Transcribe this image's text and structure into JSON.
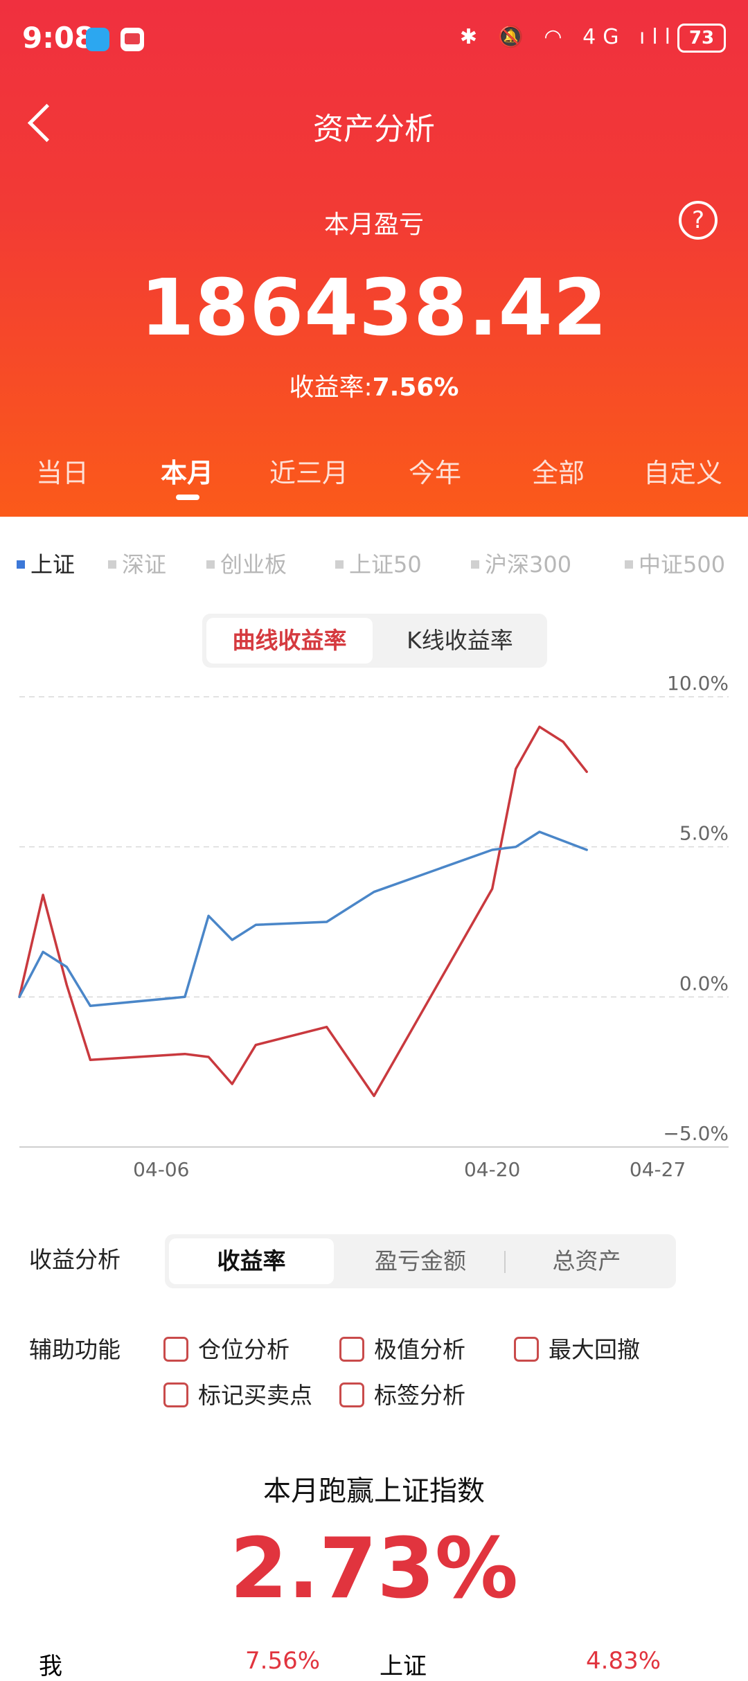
{
  "status": {
    "time": "9:08",
    "icons": "✱ 🔕 ◠ 4G ıll",
    "battery": "73"
  },
  "header": {
    "title": "资产分析"
  },
  "summary": {
    "subtitle": "本月盈亏",
    "amount": "186438.42",
    "rate_label": "收益率:",
    "rate_value": "7.56%",
    "help_icon": "?"
  },
  "period_tabs": [
    "当日",
    "本月",
    "近三月",
    "今年",
    "全部",
    "自定义"
  ],
  "active_period": 1,
  "index_tabs": [
    "上证",
    "深证",
    "创业板",
    "上证50",
    "沪深300",
    "中证500"
  ],
  "chart_mode": {
    "curve": "曲线收益率",
    "kline": "K线收益率"
  },
  "analysis": {
    "label": "收益分析",
    "options": [
      "收益率",
      "盈亏金额",
      "总资产"
    ]
  },
  "aux": {
    "label": "辅助功能",
    "options": [
      "仓位分析",
      "极值分析",
      "最大回撤",
      "标记买卖点",
      "标签分析"
    ]
  },
  "beat": {
    "title": "本月跑赢上证指数",
    "value": "2.73%"
  },
  "bottom_row": {
    "me_label": "我",
    "me_value": "7.56%",
    "index_label": "上证",
    "index_value": "4.83%"
  },
  "colors": {
    "portfolio": "#C9393E",
    "index": "#4A86C8",
    "accent": "#E1343E"
  },
  "chart_data": {
    "type": "line",
    "yticks": [
      "10.0%",
      "5.0%",
      "0.0%",
      "−5.0%"
    ],
    "ylim": [
      -5,
      10
    ],
    "xticks": [
      {
        "x": 6,
        "label": "04-06"
      },
      {
        "x": 20,
        "label": "04-20"
      },
      {
        "x": 27,
        "label": "04-27"
      }
    ],
    "xlim": [
      0,
      30
    ],
    "series": [
      {
        "color": "#C9393E",
        "points": [
          [
            0,
            0.0
          ],
          [
            1,
            3.4
          ],
          [
            2,
            0.4
          ],
          [
            3,
            -2.1
          ],
          [
            7,
            -1.9
          ],
          [
            8,
            -2.0
          ],
          [
            9,
            -2.9
          ],
          [
            10,
            -1.6
          ],
          [
            13,
            -1.0
          ],
          [
            15,
            -3.3
          ],
          [
            20,
            3.6
          ],
          [
            21,
            7.6
          ],
          [
            22,
            9.0
          ],
          [
            23,
            8.5
          ],
          [
            24,
            7.5
          ]
        ]
      },
      {
        "color": "#4A86C8",
        "points": [
          [
            0,
            0.0
          ],
          [
            1,
            1.5
          ],
          [
            2,
            1.0
          ],
          [
            3,
            -0.3
          ],
          [
            7,
            0.0
          ],
          [
            8,
            2.7
          ],
          [
            9,
            1.9
          ],
          [
            10,
            2.4
          ],
          [
            13,
            2.5
          ],
          [
            15,
            3.5
          ],
          [
            20,
            4.9
          ],
          [
            21,
            5.0
          ],
          [
            22,
            5.5
          ],
          [
            24,
            4.9
          ]
        ]
      }
    ]
  }
}
